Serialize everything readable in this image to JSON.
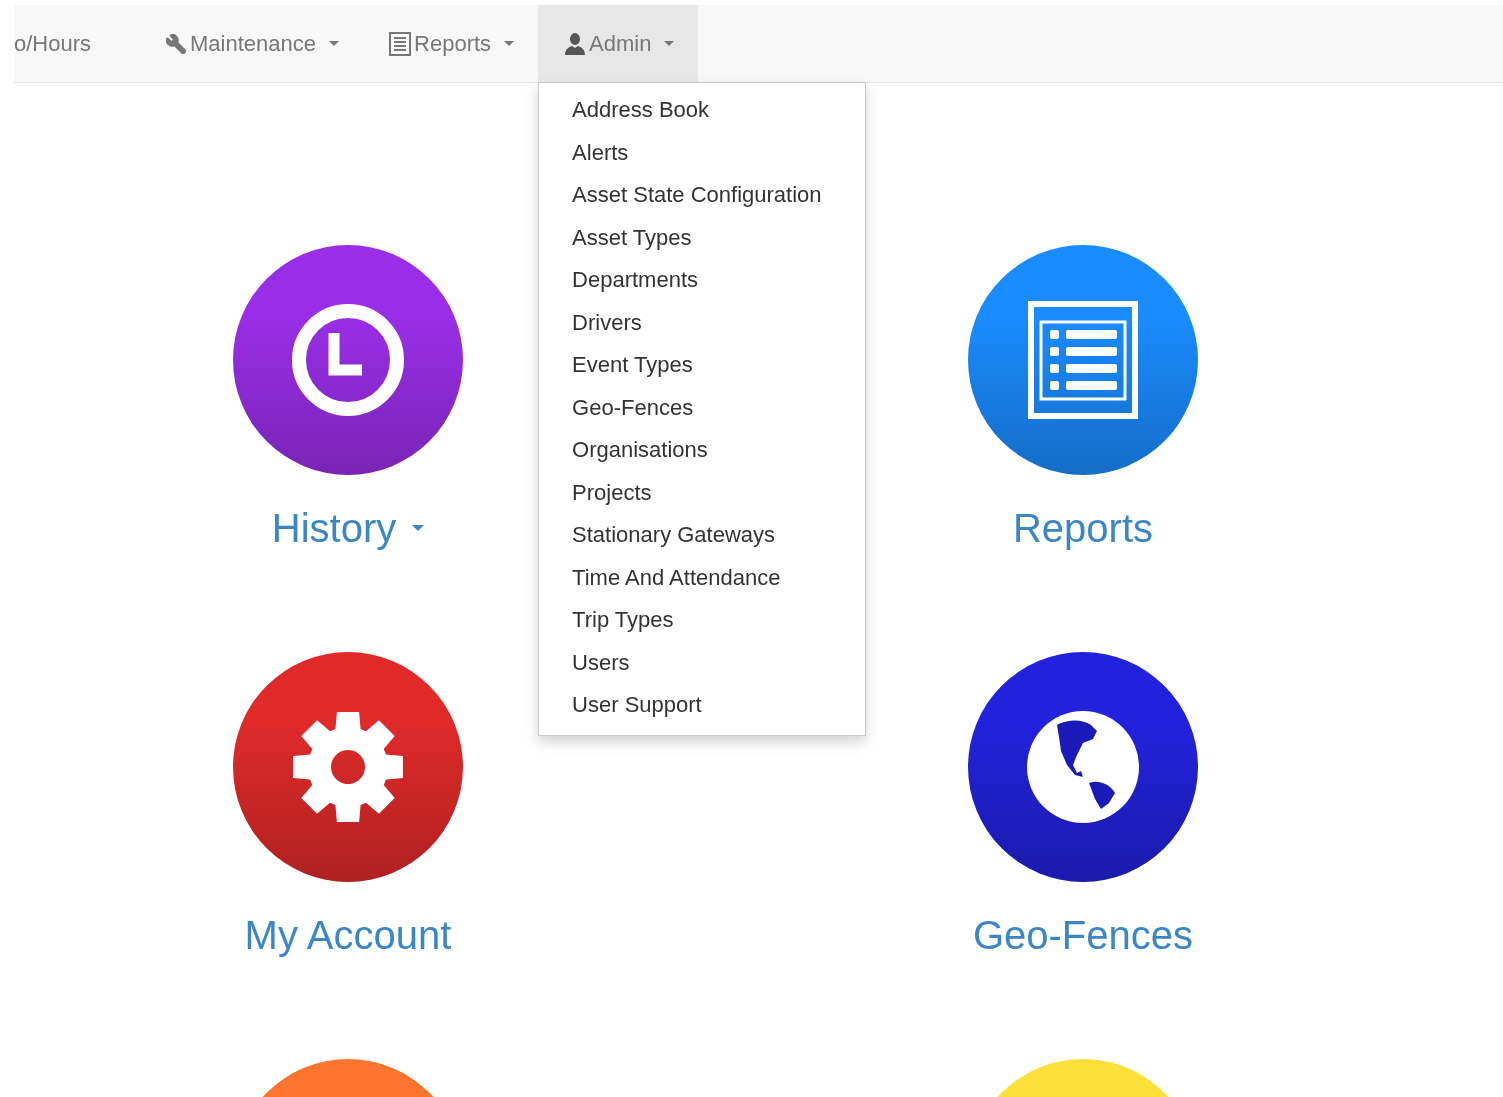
{
  "navbar": {
    "items": [
      {
        "label": "o/Hours",
        "kind": "plain",
        "dropdown": false,
        "selected": false
      },
      {
        "label": "Maintenance",
        "kind": "wrench",
        "dropdown": true,
        "selected": false
      },
      {
        "label": "Reports",
        "kind": "report",
        "dropdown": true,
        "selected": false
      },
      {
        "label": "Admin",
        "kind": "user",
        "dropdown": true,
        "selected": true
      }
    ]
  },
  "admin_menu": {
    "items": [
      "Address Book",
      "Alerts",
      "Asset State Configuration",
      "Asset Types",
      "Departments",
      "Drivers",
      "Event Types",
      "Geo-Fences",
      "Organisations",
      "Projects",
      "Stationary Gateways",
      "Time And Attendance",
      "Trip Types",
      "Users",
      "User Support"
    ]
  },
  "tiles": [
    {
      "label": "History",
      "kind": "clock",
      "color": "#9a2ee8",
      "dropdown": true
    },
    {
      "label": "Reports",
      "kind": "list",
      "color": "#1a8cff",
      "dropdown": false
    },
    {
      "label": "My Account",
      "kind": "gear",
      "color": "#e02a2a",
      "dropdown": false
    },
    {
      "label": "Geo-Fences",
      "kind": "globe",
      "color": "#2222dd",
      "dropdown": false
    },
    {
      "kind": "blank",
      "color": "#ff752d",
      "dropdown": false
    },
    {
      "kind": "blank",
      "color": "#fde03a",
      "dropdown": false
    }
  ]
}
